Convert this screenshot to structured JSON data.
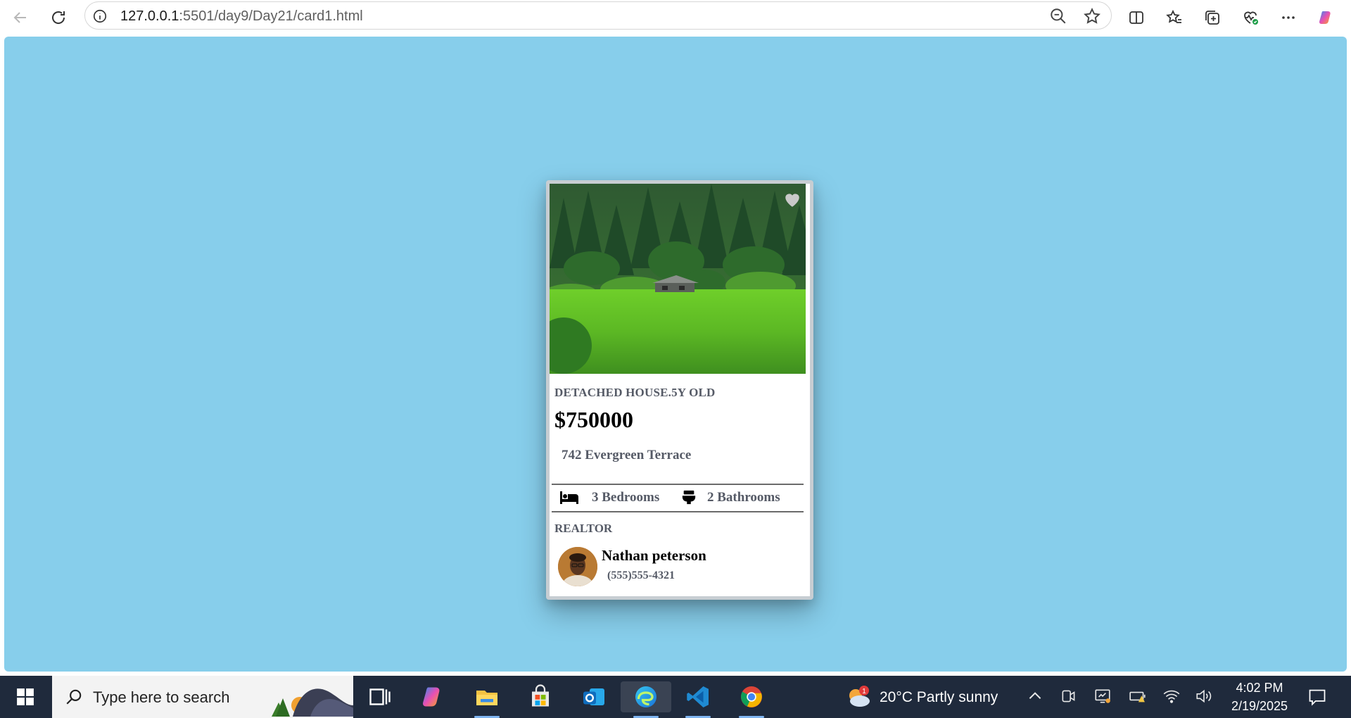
{
  "browser": {
    "url_host": "127.0.0.1",
    "url_rest": ":5501/day9/Day21/card1.html"
  },
  "card": {
    "property_type": "DETACHED HOUSE.5Y OLD",
    "price": "$750000",
    "address": "742 Evergreen Terrace",
    "bedrooms": "3 Bedrooms",
    "bathrooms": "2 Bathrooms",
    "realtor_heading": "REALTOR",
    "agent_name": "Nathan peterson",
    "agent_phone": "(555)555-4321",
    "background_color": "#87ceeb"
  },
  "taskbar": {
    "search_placeholder": "Type here to search",
    "weather_text": "20°C  Partly sunny",
    "weather_badge": "1",
    "time": "4:02 PM",
    "date": "2/19/2025"
  }
}
